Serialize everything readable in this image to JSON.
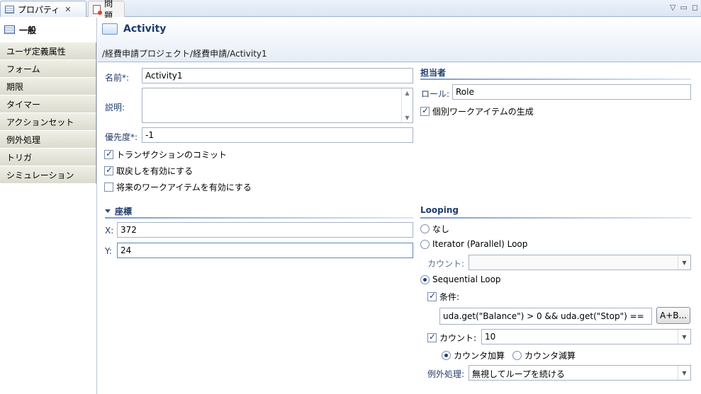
{
  "view_tabs": {
    "properties_label": "プロパティ",
    "problems_label": "問題"
  },
  "sidebar": {
    "items": [
      {
        "label": "一般"
      },
      {
        "label": "ユーザ定義属性"
      },
      {
        "label": "フォーム"
      },
      {
        "label": "期限"
      },
      {
        "label": "タイマー"
      },
      {
        "label": "アクションセット"
      },
      {
        "label": "例外処理"
      },
      {
        "label": "トリガ"
      },
      {
        "label": "シミュレーション"
      }
    ]
  },
  "header": {
    "title": "Activity",
    "path": "/経費申請プロジェクト/経費申請/Activity1"
  },
  "general": {
    "name_label": "名前*:",
    "name_value": "Activity1",
    "description_label": "説明:",
    "description_value": "",
    "priority_label": "優先度*:",
    "priority_value": "-1",
    "commit_transaction_label": "トランザクションのコミット",
    "enable_undo_label": "取戻しを有効にする",
    "enable_future_workitem_label": "将来のワークアイテムを有効にする"
  },
  "assignee": {
    "section_title": "担当者",
    "role_label": "ロール:",
    "role_value": "Role",
    "individual_workitem_label": "個別ワークアイテムの生成"
  },
  "coordinates": {
    "section_title": "座標",
    "x_label": "X:",
    "x_value": "372",
    "y_label": "Y:",
    "y_value": "24"
  },
  "looping": {
    "section_title": "Looping",
    "none_label": "なし",
    "iterator_label": "Iterator (Parallel) Loop",
    "count_label": "カウント:",
    "count_value": "",
    "sequential_label": "Sequential Loop",
    "condition_label": "条件:",
    "condition_value": "uda.get(\"Balance\")  >  0  &&  uda.get(\"Stop\")  ==",
    "expression_button_label": "A+B...",
    "seq_count_label": "カウント:",
    "seq_count_value": "10",
    "count_up_label": "カウンタ加算",
    "count_down_label": "カウンタ減算",
    "exception_label": "例外処理:",
    "exception_value": "無視してループを続ける"
  }
}
